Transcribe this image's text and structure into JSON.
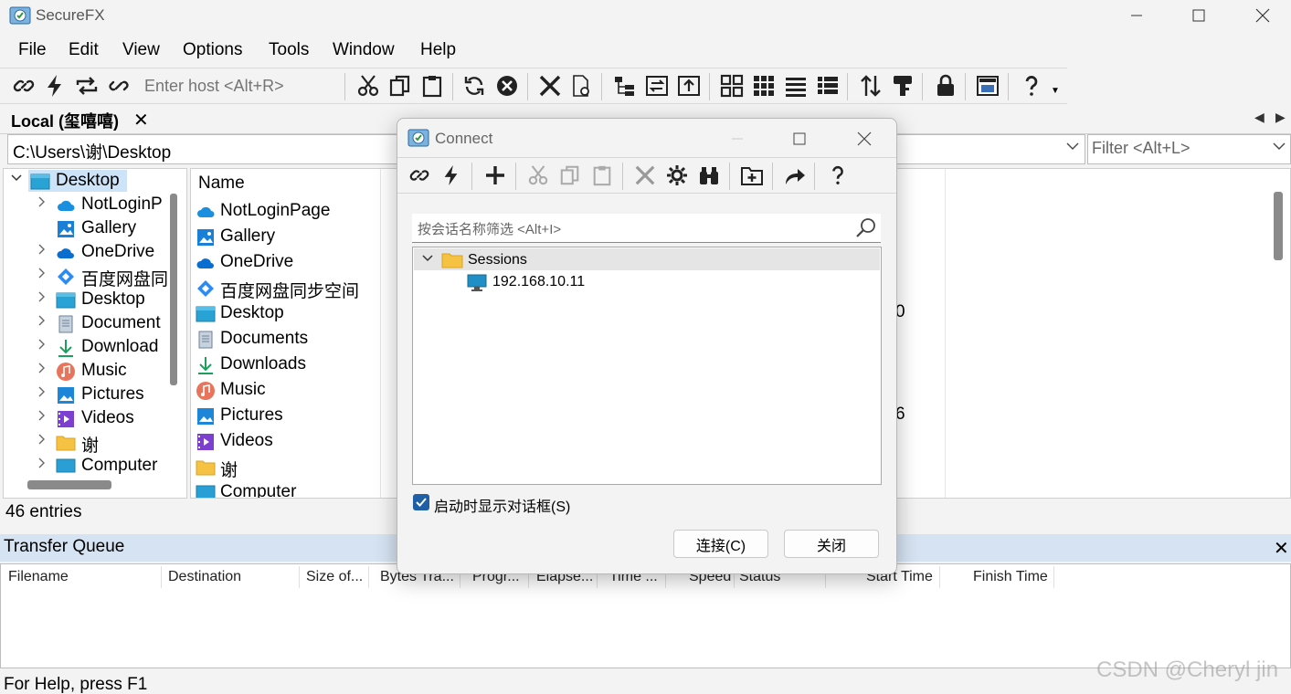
{
  "app": {
    "title": "SecureFX"
  },
  "menu": [
    "File",
    "Edit",
    "View",
    "Options",
    "Tools",
    "Window",
    "Help"
  ],
  "toolbar": {
    "host_placeholder": "Enter host <Alt+R>"
  },
  "local_tab": {
    "label": "Local (玺嘻嘻)",
    "close": "✕"
  },
  "path": {
    "value": "C:\\Users\\谢\\Desktop",
    "filter_placeholder": "Filter <Alt+L>"
  },
  "tree": {
    "items": [
      {
        "label": "Desktop",
        "icon": "desktop-icon",
        "expanded": true
      },
      {
        "label": "NotLoginP",
        "icon": "cloud-icon"
      },
      {
        "label": "Gallery",
        "icon": "gallery-icon"
      },
      {
        "label": "OneDrive",
        "icon": "onedrive-icon"
      },
      {
        "label": "百度网盘同",
        "icon": "baidu-icon"
      },
      {
        "label": "Desktop",
        "icon": "desktop-icon"
      },
      {
        "label": "Document",
        "icon": "document-icon"
      },
      {
        "label": "Download",
        "icon": "download-icon"
      },
      {
        "label": "Music",
        "icon": "music-icon"
      },
      {
        "label": "Pictures",
        "icon": "pictures-icon"
      },
      {
        "label": "Videos",
        "icon": "videos-icon"
      },
      {
        "label": "谢",
        "icon": "folder-icon"
      },
      {
        "label": "Computer",
        "icon": "computer-icon"
      }
    ]
  },
  "file_list": {
    "column_name": "Name",
    "items": [
      {
        "label": "NotLoginPage",
        "icon": "cloud-icon"
      },
      {
        "label": "Gallery",
        "icon": "gallery-icon"
      },
      {
        "label": "OneDrive",
        "icon": "onedrive-icon"
      },
      {
        "label": "百度网盘同步空间",
        "icon": "baidu-icon"
      },
      {
        "label": "Desktop",
        "icon": "desktop-icon"
      },
      {
        "label": "Documents",
        "icon": "document-icon"
      },
      {
        "label": "Downloads",
        "icon": "download-icon"
      },
      {
        "label": "Music",
        "icon": "music-icon"
      },
      {
        "label": "Pictures",
        "icon": "pictures-icon"
      },
      {
        "label": "Videos",
        "icon": "videos-icon"
      },
      {
        "label": "谢",
        "icon": "folder-icon"
      },
      {
        "label": "Computer",
        "icon": "computer-icon"
      }
    ],
    "fragment1": "0",
    "fragment2": "6"
  },
  "status": {
    "entries": "46 entries",
    "help": "For Help, press F1"
  },
  "transfer_queue": {
    "title": "Transfer Queue",
    "columns": [
      "Filename",
      "Destination",
      "Size of...",
      "Bytes Tra...",
      "Progr...",
      "Elapse...",
      "Time ...",
      "Speed",
      "Status",
      "Start Time",
      "Finish Time"
    ]
  },
  "dialog": {
    "title": "Connect",
    "search_placeholder": "按会话名称筛选 <Alt+I>",
    "sessions_label": "Sessions",
    "host_label": "192.168.10.11",
    "checkbox_label": "启动时显示对话框(S)",
    "checkbox_checked": true,
    "connect_button": "连接(C)",
    "close_button": "关闭"
  },
  "watermark": "CSDN @Cheryl jin",
  "colors": {
    "accent": "#1f5fa6",
    "queue_header": "#d6e3f2",
    "folder": "#f6c244"
  }
}
